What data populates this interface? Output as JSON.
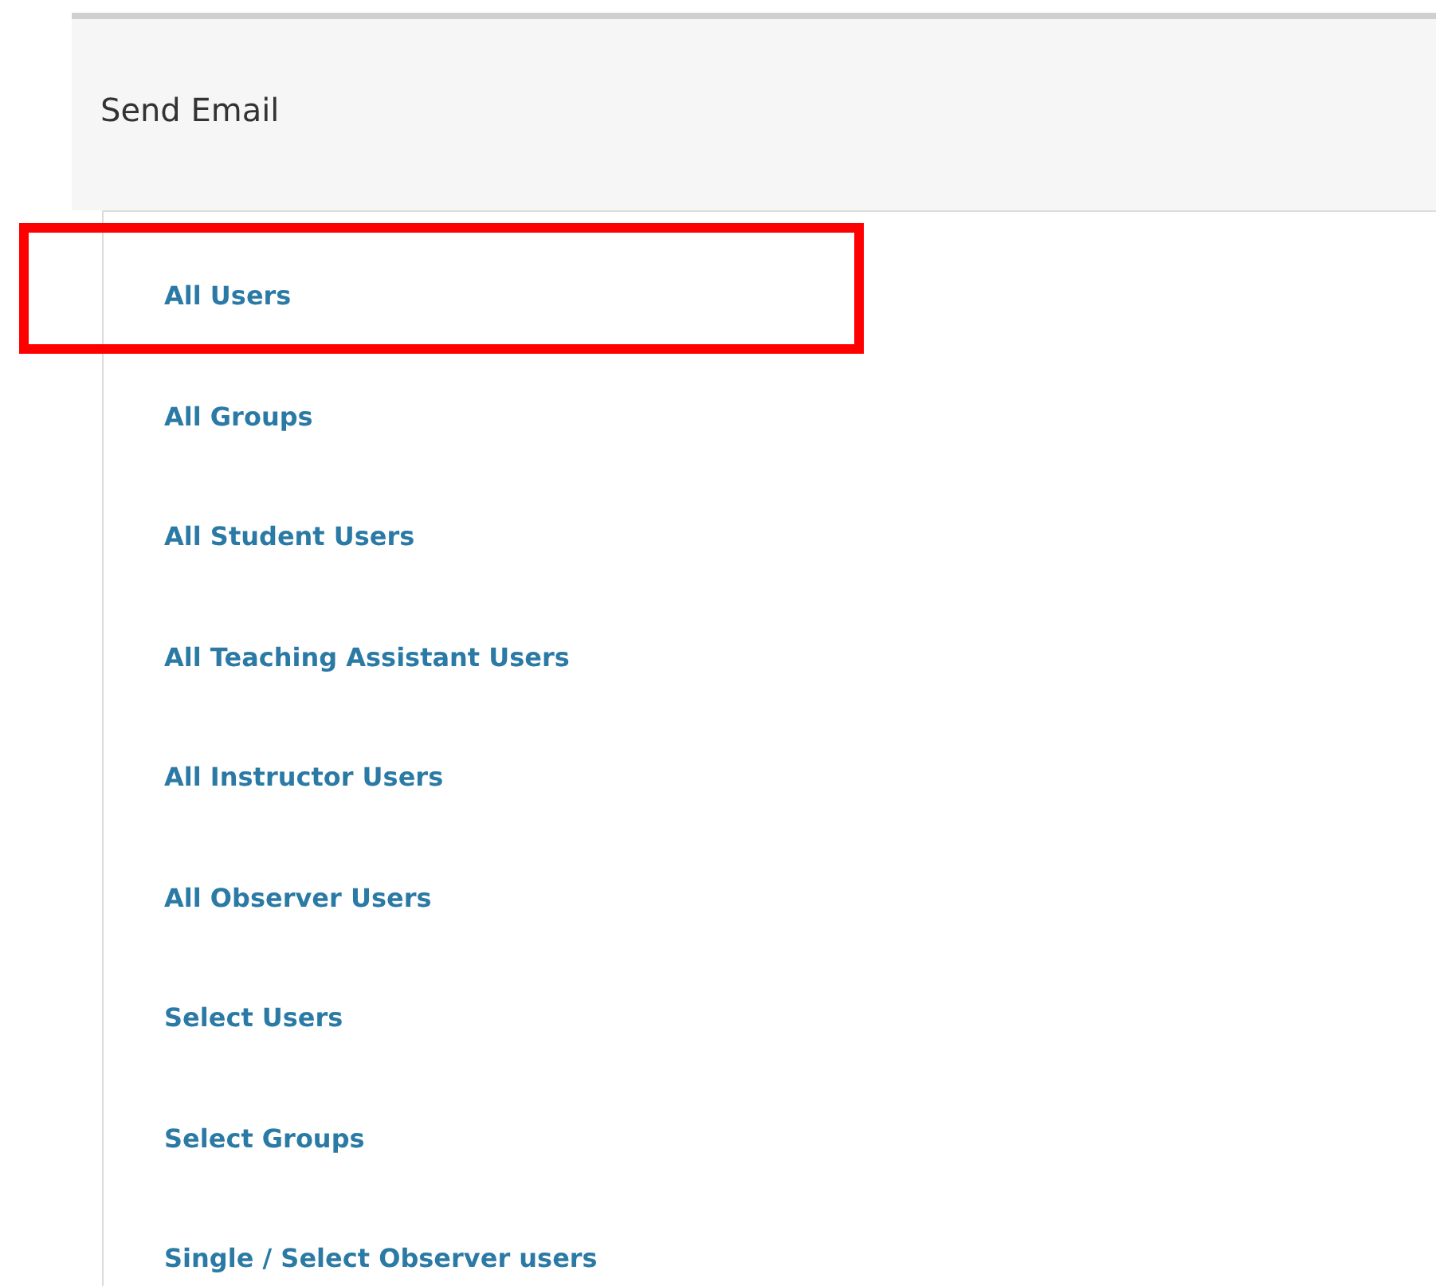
{
  "page": {
    "title": "Send Email"
  },
  "recipient_options": [
    {
      "label": "All Users",
      "highlighted": true
    },
    {
      "label": "All Groups",
      "highlighted": false
    },
    {
      "label": "All Student Users",
      "highlighted": false
    },
    {
      "label": "All Teaching Assistant Users",
      "highlighted": false
    },
    {
      "label": "All Instructor Users",
      "highlighted": false
    },
    {
      "label": "All Observer Users",
      "highlighted": false
    },
    {
      "label": "Select Users",
      "highlighted": false
    },
    {
      "label": "Select Groups",
      "highlighted": false
    },
    {
      "label": "Single / Select Observer users",
      "highlighted": false
    }
  ]
}
